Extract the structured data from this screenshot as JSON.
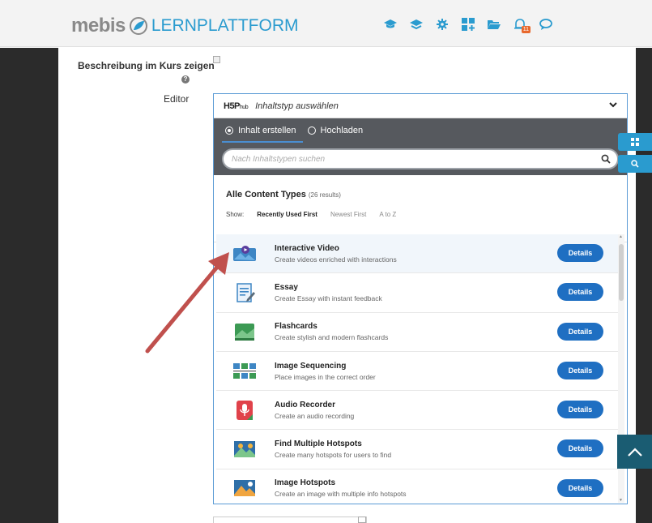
{
  "header": {
    "logo_main": "mebis",
    "logo_sub": "LERNPLATTFORM",
    "nav_icons": [
      "graduation-cap-icon",
      "courses-icon",
      "gear-icon",
      "grid-plus-icon",
      "folder-icon",
      "bell-icon",
      "chat-icon"
    ],
    "notification_count": "11"
  },
  "form": {
    "beschreibung_label": "Beschreibung im Kurs zeigen",
    "help_glyph": "?",
    "editor_label": "Editor"
  },
  "hub": {
    "logo": "H5P",
    "logo_sub": "hub",
    "title": "Inhaltstyp auswählen",
    "tabs": [
      {
        "label": "Inhalt erstellen",
        "active": true
      },
      {
        "label": "Hochladen",
        "active": false
      }
    ],
    "search_placeholder": "Nach Inhaltstypen suchen",
    "list_title": "Alle Content Types",
    "list_count": "(26 results)",
    "show_label": "Show:",
    "filters": [
      "Recently Used First",
      "Newest First",
      "A to Z"
    ],
    "details_label": "Details",
    "items": [
      {
        "name": "Interactive Video",
        "desc": "Create videos enriched with interactions",
        "icon": "interactive-video-icon"
      },
      {
        "name": "Essay",
        "desc": "Create Essay with instant feedback",
        "icon": "essay-icon"
      },
      {
        "name": "Flashcards",
        "desc": "Create stylish and modern flashcards",
        "icon": "flashcards-icon"
      },
      {
        "name": "Image Sequencing",
        "desc": "Place images in the correct order",
        "icon": "image-sequencing-icon"
      },
      {
        "name": "Audio Recorder",
        "desc": "Create an audio recording",
        "icon": "audio-recorder-icon"
      },
      {
        "name": "Find Multiple Hotspots",
        "desc": "Create many hotspots for users to find",
        "icon": "find-multiple-hotspots-icon"
      },
      {
        "name": "Image Hotspots",
        "desc": "Create an image with multiple info hotspots",
        "icon": "image-hotspots-icon"
      }
    ]
  },
  "colors": {
    "accent": "#2a9bcf",
    "details_button": "#1f6fc2",
    "tab_bar": "#56595e",
    "arrow": "#c0504d",
    "badge": "#e8682c"
  }
}
